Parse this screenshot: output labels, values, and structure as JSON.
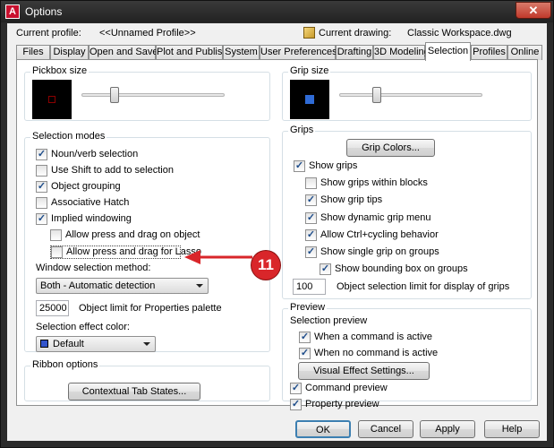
{
  "window": {
    "title": "Options",
    "close_glyph": "✕"
  },
  "header": {
    "current_profile_label": "Current profile:",
    "current_profile_value": "<<Unnamed Profile>>",
    "current_drawing_label": "Current drawing:",
    "current_drawing_value": "Classic Workspace.dwg"
  },
  "tabs": [
    {
      "label": "Files"
    },
    {
      "label": "Display"
    },
    {
      "label": "Open and Save"
    },
    {
      "label": "Plot and Publish"
    },
    {
      "label": "System"
    },
    {
      "label": "User Preferences"
    },
    {
      "label": "Drafting"
    },
    {
      "label": "3D Modeling"
    },
    {
      "label": "Selection"
    },
    {
      "label": "Profiles"
    },
    {
      "label": "Online"
    }
  ],
  "pickbox": {
    "label": "Pickbox size",
    "level": 0.2
  },
  "grip_size": {
    "label": "Grip size",
    "level": 0.25
  },
  "selection_modes": {
    "label": "Selection modes",
    "items": [
      {
        "label": "Noun/verb selection",
        "checked": true
      },
      {
        "label": "Use Shift to add to selection",
        "checked": false
      },
      {
        "label": "Object grouping",
        "checked": true
      },
      {
        "label": "Associative Hatch",
        "checked": false
      },
      {
        "label": "Implied windowing",
        "checked": true
      },
      {
        "label": "Allow press and drag on object",
        "checked": false
      },
      {
        "label": "Allow press and drag for Lasso",
        "checked": false
      }
    ],
    "window_method_label": "Window selection method:",
    "window_method_value": "Both - Automatic detection",
    "object_limit_value": "25000",
    "object_limit_label": "Object limit for Properties palette",
    "effect_color_label": "Selection effect color:",
    "effect_color_value": "Default",
    "effect_color_swatch": "#3355cc"
  },
  "ribbon": {
    "label": "Ribbon options",
    "contextual_button": "Contextual Tab States..."
  },
  "grips": {
    "label": "Grips",
    "colors_button": "Grip Colors...",
    "items": [
      {
        "label": "Show grips",
        "checked": true
      },
      {
        "label": "Show grips within blocks",
        "checked": false
      },
      {
        "label": "Show grip tips",
        "checked": true
      },
      {
        "label": "Show dynamic grip menu",
        "checked": true
      },
      {
        "label": "Allow Ctrl+cycling behavior",
        "checked": true
      },
      {
        "label": "Show single grip on groups",
        "checked": true
      },
      {
        "label": "Show bounding box on groups",
        "checked": true
      }
    ],
    "limit_value": "100",
    "limit_label": "Object selection limit for display of grips"
  },
  "preview": {
    "label": "Preview",
    "sub_label": "Selection preview",
    "items": [
      {
        "label": "When a command is active",
        "checked": true
      },
      {
        "label": "When no command is active",
        "checked": true
      }
    ],
    "visual_button": "Visual Effect Settings...",
    "extra_items": [
      {
        "label": "Command preview",
        "checked": true
      },
      {
        "label": "Property preview",
        "checked": true
      }
    ]
  },
  "annotation": {
    "number": "11",
    "color": "#d9262a"
  },
  "footer": {
    "ok": "OK",
    "cancel": "Cancel",
    "apply": "Apply",
    "help": "Help"
  },
  "colors": {
    "pickbox_square": "#8b0000",
    "grip_square": "#2f6bd6"
  }
}
